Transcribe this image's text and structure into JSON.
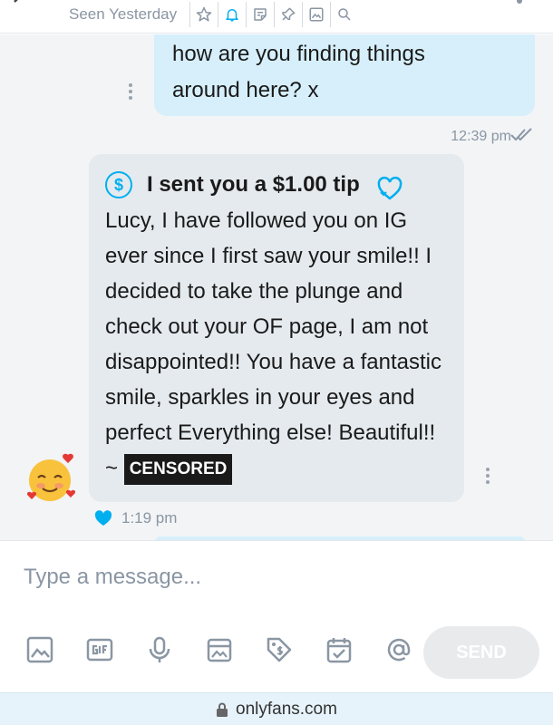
{
  "header": {
    "seen_text": "Seen Yesterday",
    "icons": [
      "star-icon",
      "bell-icon",
      "note-icon",
      "pin-icon",
      "image-icon",
      "search-icon"
    ]
  },
  "messages": {
    "outgoing": {
      "text": "how are you finding things\naround here? x",
      "time": "12:39 pm"
    },
    "incoming": {
      "tip_title": "I sent you a $1.00 tip",
      "text": "Lucy, I have followed you on IG ever since I first saw your smile!! I decided to take the plunge and check out your OF page, I am not disappointed!! You have a fantastic smile, sparkles in your eyes and perfect Everything else! Beautiful!! ~ ",
      "censored_label": "CENSORED",
      "time": "1:19 pm"
    }
  },
  "composer": {
    "placeholder": "Type a message...",
    "send_label": "SEND",
    "tools": [
      "image-icon",
      "gif-icon",
      "microphone-icon",
      "vault-icon",
      "price-tag-icon",
      "schedule-icon",
      "mention-icon"
    ]
  },
  "browser": {
    "url": "onlyfans.com"
  },
  "colors": {
    "accent": "#00aff0",
    "outgoing_bubble": "#d6effb",
    "incoming_bubble": "#e5eaee",
    "muted_text": "#8a96a3"
  }
}
